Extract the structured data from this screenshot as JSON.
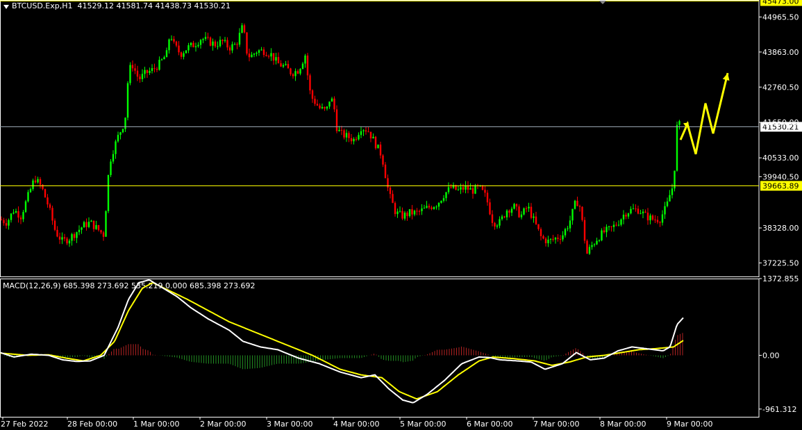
{
  "header": {
    "symbol": "BTCUSD.Exp,H1",
    "ohlc": "41529.12 41581.74 41438.73 41530.21"
  },
  "macd": {
    "label": "MACD(12,26,9) 685.398 273.692 535.219 0.000 685.398 273.692"
  },
  "colors": {
    "background": "#000000",
    "bull_candle": "#00ff00",
    "bear_candle": "#ff0000",
    "hline": "#ffff00",
    "bid_line": "#9aa6b2",
    "macd_line": "#ffffff",
    "signal_line": "#ffff00",
    "hist_pos": "#b22222",
    "hist_neg": "#228b22",
    "arrow": "#ffff00",
    "axis": "#ffffff"
  },
  "chart_data": [
    {
      "type": "candlestick",
      "symbol": "BTCUSD.Exp",
      "timeframe": "H1",
      "ylim": [
        36800,
        45500
      ],
      "price_ticks": [
        "44965.50",
        "43863.00",
        "42760.50",
        "41650.00",
        "40533.00",
        "39940.50",
        "38328.00",
        "37225.50"
      ],
      "horizontal_lines": [
        {
          "label": "45473.00",
          "value": 45473.0,
          "kind": "level"
        },
        {
          "label": "39663.89",
          "value": 39663.89,
          "kind": "level"
        },
        {
          "label": "41530.21",
          "value": 41530.21,
          "kind": "bid"
        }
      ],
      "x_labels": [
        "27 Feb 2022",
        "28 Feb 00:00",
        "1 Mar 00:00",
        "2 Mar 00:00",
        "3 Mar 00:00",
        "4 Mar 00:00",
        "5 Mar 00:00",
        "6 Mar 00:00",
        "7 Mar 00:00",
        "8 Mar 00:00",
        "9 Mar 00:00"
      ],
      "close_anchors": [
        [
          0,
          38600
        ],
        [
          10,
          38500
        ],
        [
          20,
          38900
        ],
        [
          30,
          38700
        ],
        [
          40,
          39300
        ],
        [
          50,
          39900
        ],
        [
          60,
          39600
        ],
        [
          70,
          39000
        ],
        [
          80,
          38200
        ],
        [
          90,
          37900
        ],
        [
          100,
          38000
        ],
        [
          110,
          38200
        ],
        [
          120,
          38400
        ],
        [
          130,
          38500
        ],
        [
          140,
          38300
        ],
        [
          150,
          38100
        ],
        [
          155,
          39800
        ],
        [
          160,
          40600
        ],
        [
          170,
          41200
        ],
        [
          180,
          41700
        ],
        [
          185,
          43200
        ],
        [
          190,
          43500
        ],
        [
          200,
          43000
        ],
        [
          210,
          43200
        ],
        [
          220,
          43300
        ],
        [
          230,
          43500
        ],
        [
          240,
          43800
        ],
        [
          245,
          44500
        ],
        [
          250,
          44100
        ],
        [
          260,
          43800
        ],
        [
          270,
          44000
        ],
        [
          280,
          44100
        ],
        [
          290,
          44300
        ],
        [
          300,
          44200
        ],
        [
          310,
          44100
        ],
        [
          320,
          44200
        ],
        [
          330,
          44000
        ],
        [
          340,
          44100
        ],
        [
          345,
          44400
        ],
        [
          350,
          44700
        ],
        [
          355,
          43900
        ],
        [
          360,
          43700
        ],
        [
          370,
          43900
        ],
        [
          380,
          43900
        ],
        [
          390,
          43800
        ],
        [
          400,
          43500
        ],
        [
          410,
          43400
        ],
        [
          420,
          43200
        ],
        [
          430,
          43300
        ],
        [
          440,
          43800
        ],
        [
          445,
          42700
        ],
        [
          450,
          42400
        ],
        [
          460,
          42100
        ],
        [
          470,
          42000
        ],
        [
          475,
          42400
        ],
        [
          480,
          42300
        ],
        [
          485,
          41500
        ],
        [
          490,
          41300
        ],
        [
          500,
          41200
        ],
        [
          510,
          41100
        ],
        [
          520,
          41500
        ],
        [
          530,
          41400
        ],
        [
          540,
          41000
        ],
        [
          550,
          40600
        ],
        [
          555,
          40000
        ],
        [
          560,
          39400
        ],
        [
          570,
          38800
        ],
        [
          580,
          38700
        ],
        [
          590,
          38800
        ],
        [
          600,
          38800
        ],
        [
          610,
          38900
        ],
        [
          620,
          39000
        ],
        [
          630,
          39100
        ],
        [
          640,
          39400
        ],
        [
          650,
          39600
        ],
        [
          660,
          39500
        ],
        [
          670,
          39600
        ],
        [
          680,
          39500
        ],
        [
          690,
          39600
        ],
        [
          700,
          39300
        ],
        [
          705,
          38900
        ],
        [
          710,
          38500
        ],
        [
          720,
          38500
        ],
        [
          730,
          38900
        ],
        [
          740,
          39000
        ],
        [
          750,
          38700
        ],
        [
          760,
          39000
        ],
        [
          770,
          38500
        ],
        [
          780,
          38000
        ],
        [
          790,
          37900
        ],
        [
          800,
          38000
        ],
        [
          810,
          38100
        ],
        [
          820,
          38500
        ],
        [
          830,
          39200
        ],
        [
          835,
          39000
        ],
        [
          840,
          38300
        ],
        [
          845,
          37500
        ],
        [
          850,
          37700
        ],
        [
          860,
          38000
        ],
        [
          870,
          38200
        ],
        [
          880,
          38300
        ],
        [
          890,
          38500
        ],
        [
          900,
          38800
        ],
        [
          910,
          38900
        ],
        [
          920,
          38900
        ],
        [
          930,
          38700
        ],
        [
          940,
          38600
        ],
        [
          950,
          38600
        ],
        [
          960,
          39000
        ],
        [
          965,
          39400
        ],
        [
          970,
          39700
        ],
        [
          975,
          41500
        ],
        [
          980,
          41600
        ]
      ]
    },
    {
      "type": "line",
      "name": "MACD(12,26,9)",
      "ylim": [
        -1100,
        1372.855
      ],
      "y_ticks": [
        "1372.855",
        "0.00",
        "-961.312"
      ],
      "macd_anchors": [
        [
          0,
          50
        ],
        [
          20,
          -30
        ],
        [
          45,
          20
        ],
        [
          70,
          0
        ],
        [
          90,
          -80
        ],
        [
          110,
          -110
        ],
        [
          130,
          -100
        ],
        [
          150,
          0
        ],
        [
          170,
          500
        ],
        [
          185,
          1000
        ],
        [
          200,
          1300
        ],
        [
          215,
          1350
        ],
        [
          235,
          1200
        ],
        [
          255,
          1050
        ],
        [
          275,
          850
        ],
        [
          300,
          650
        ],
        [
          330,
          450
        ],
        [
          350,
          250
        ],
        [
          375,
          150
        ],
        [
          400,
          100
        ],
        [
          430,
          -50
        ],
        [
          460,
          -150
        ],
        [
          490,
          -300
        ],
        [
          520,
          -400
        ],
        [
          540,
          -350
        ],
        [
          560,
          -600
        ],
        [
          580,
          -800
        ],
        [
          595,
          -850
        ],
        [
          615,
          -700
        ],
        [
          640,
          -450
        ],
        [
          665,
          -150
        ],
        [
          690,
          -30
        ],
        [
          705,
          -40
        ],
        [
          720,
          -80
        ],
        [
          745,
          -100
        ],
        [
          765,
          -120
        ],
        [
          785,
          -250
        ],
        [
          810,
          -150
        ],
        [
          830,
          50
        ],
        [
          850,
          -80
        ],
        [
          870,
          -50
        ],
        [
          890,
          80
        ],
        [
          910,
          150
        ],
        [
          930,
          120
        ],
        [
          955,
          80
        ],
        [
          965,
          150
        ],
        [
          975,
          550
        ],
        [
          985,
          685
        ]
      ],
      "signal_anchors": [
        [
          0,
          40
        ],
        [
          40,
          0
        ],
        [
          70,
          10
        ],
        [
          95,
          -50
        ],
        [
          120,
          -100
        ],
        [
          145,
          0
        ],
        [
          165,
          250
        ],
        [
          185,
          800
        ],
        [
          205,
          1200
        ],
        [
          220,
          1300
        ],
        [
          245,
          1150
        ],
        [
          270,
          1000
        ],
        [
          300,
          800
        ],
        [
          330,
          600
        ],
        [
          360,
          450
        ],
        [
          390,
          300
        ],
        [
          420,
          150
        ],
        [
          450,
          0
        ],
        [
          490,
          -250
        ],
        [
          520,
          -350
        ],
        [
          550,
          -400
        ],
        [
          575,
          -650
        ],
        [
          600,
          -780
        ],
        [
          630,
          -650
        ],
        [
          660,
          -350
        ],
        [
          690,
          -100
        ],
        [
          710,
          -30
        ],
        [
          740,
          -60
        ],
        [
          770,
          -100
        ],
        [
          795,
          -180
        ],
        [
          820,
          -120
        ],
        [
          845,
          -30
        ],
        [
          870,
          0
        ],
        [
          895,
          50
        ],
        [
          920,
          100
        ],
        [
          945,
          120
        ],
        [
          970,
          150
        ],
        [
          985,
          274
        ]
      ]
    }
  ]
}
